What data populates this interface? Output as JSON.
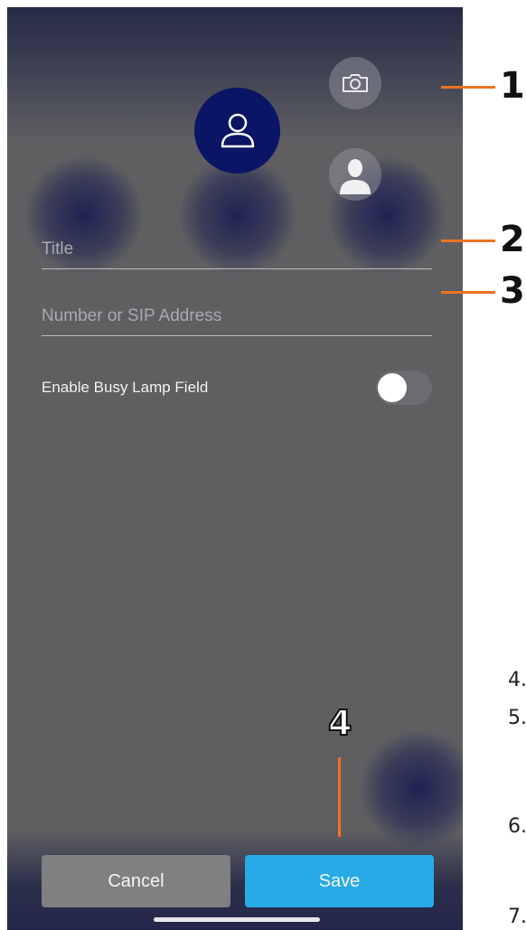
{
  "form": {
    "title_placeholder": "Title",
    "number_placeholder": "Number or SIP Address",
    "blf_label": "Enable Busy Lamp Field",
    "blf_enabled": false
  },
  "buttons": {
    "cancel": "Cancel",
    "save": "Save"
  },
  "icons": {
    "avatar": "person-outline-icon",
    "camera": "camera-icon",
    "contact_photo": "person-silhouette-icon"
  },
  "callouts": {
    "one": "1",
    "two": "2",
    "three": "3",
    "four": "4"
  },
  "side_list": [
    "4.",
    "5.",
    "6.",
    "7."
  ],
  "colors": {
    "avatar_bg": "#0b1565",
    "save_button": "#28aae6",
    "cancel_button": "#808083",
    "callout_line": "#ef7321"
  }
}
